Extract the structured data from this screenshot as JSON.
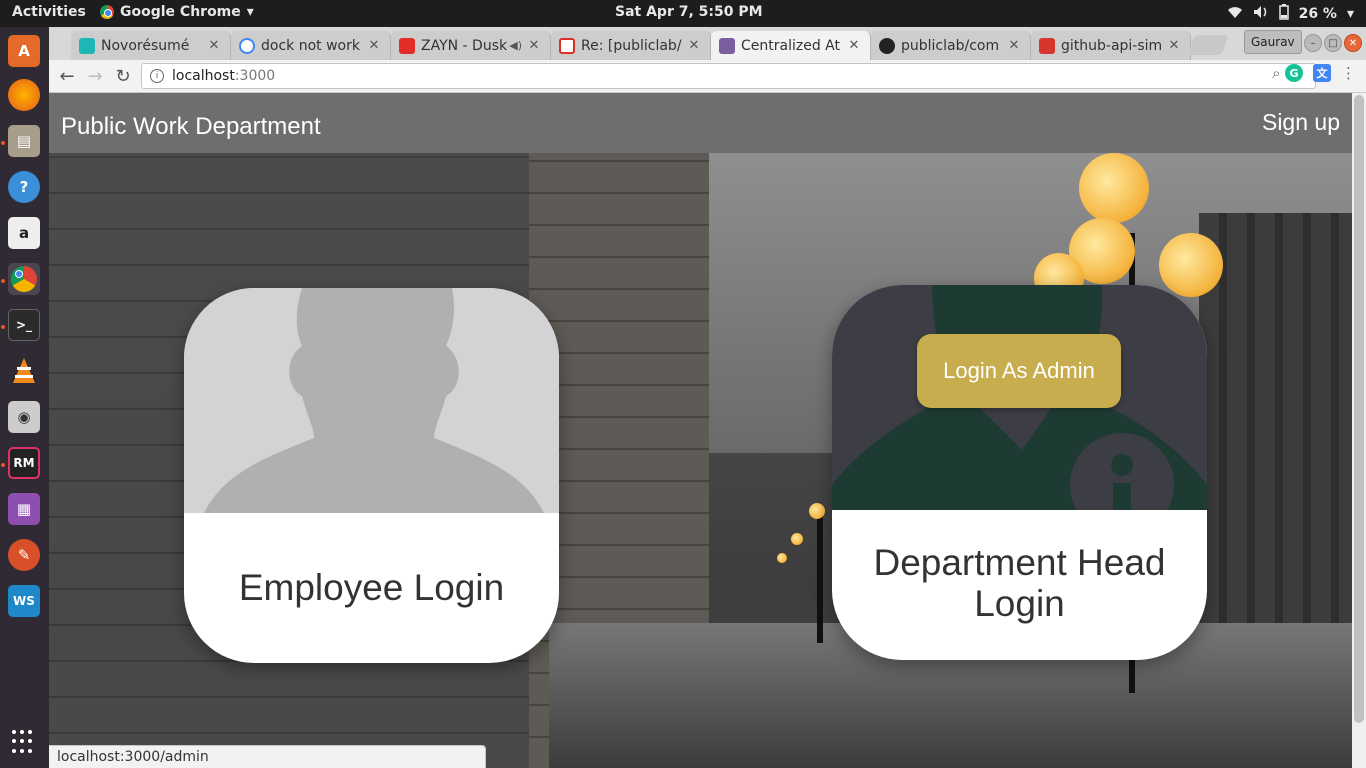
{
  "topbar": {
    "activities": "Activities",
    "app_name": "Google Chrome",
    "clock": "Sat Apr  7,  5:50 PM",
    "battery": "26 %"
  },
  "launcher": {
    "items": [
      "software-center",
      "firefox",
      "files",
      "help",
      "amazon",
      "chrome",
      "terminal",
      "vlc",
      "screenshot",
      "rubymine",
      "video-editor",
      "settings",
      "webstorm"
    ]
  },
  "tabs": [
    {
      "label": "Novorésumé",
      "favicon_color": "#1fb6b6"
    },
    {
      "label": "dock not work",
      "favicon_color": "#4285f4"
    },
    {
      "label": "ZAYN - Dusk",
      "favicon_color": "#e52d27"
    },
    {
      "label": "Re: [publiclab/",
      "favicon_color": "#d93025"
    },
    {
      "label": "Centralized At",
      "favicon_color": "#7a5fa0"
    },
    {
      "label": "publiclab/com",
      "favicon_color": "#222222"
    },
    {
      "label": "github-api-sim",
      "favicon_color": "#d6362d"
    }
  ],
  "active_tab_index": 4,
  "profile": "Gaurav",
  "omnibox": {
    "host": "localhost",
    "path": ":3000"
  },
  "page": {
    "brand": "Public Work Department",
    "signup": "Sign up",
    "employee_card": {
      "label": "Employee Login"
    },
    "admin_card": {
      "button": "Login As Admin",
      "label_line1": "Department Head",
      "label_line2": "Login"
    }
  },
  "status_url": "localhost:3000/admin",
  "colors": {
    "navbar": "#6e6e6e",
    "admin_button": "#c8ad4f",
    "admin_header": "#3d3d45",
    "employee_header": "#d3d3d3"
  }
}
